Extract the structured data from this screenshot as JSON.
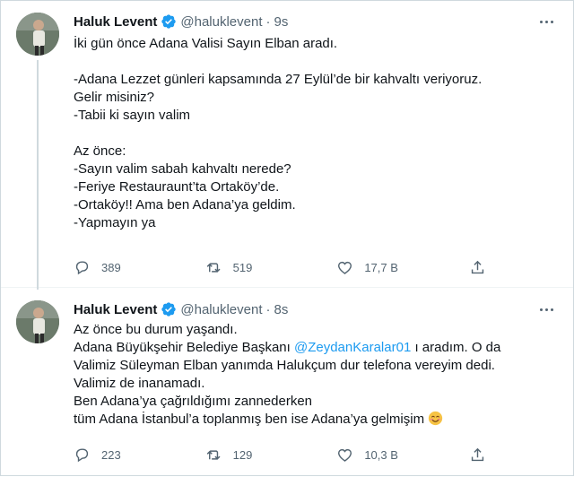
{
  "tweets": [
    {
      "author_name": "Haluk Levent",
      "handle": "@haluklevent",
      "separator": "·",
      "time": "9s",
      "lines": [
        "İki gün önce Adana Valisi Sayın Elban aradı.",
        "",
        "-Adana Lezzet günleri kapsamında 27 Eylül’de bir kahvaltı veriyoruz.",
        "Gelir misiniz?",
        "-Tabii ki sayın valim",
        "",
        "Az önce:",
        "-Sayın valim sabah kahvaltı nerede?",
        "-Feriye Restauraunt’ta Ortaköy’de.",
        "-Ortaköy!! Ama ben Adana’ya geldim.",
        "-Yapmayın ya"
      ],
      "reply_count": "389",
      "retweet_count": "519",
      "like_count": "17,7 B"
    },
    {
      "author_name": "Haluk Levent",
      "handle": "@haluklevent",
      "separator": "·",
      "time": "8s",
      "line1": "Az önce bu durum yaşandı.",
      "line2_before": "Adana Büyükşehir Belediye Başkanı ",
      "line2_mention": "@ZeydanKaralar01",
      "line2_after": " ı aradım. O da",
      "line3": "Valimiz Süleyman Elban yanımda Halukçum dur telefona vereyim dedi.",
      "line4": "Valimiz de inanamadı.",
      "line5": "Ben Adana’ya çağrıldığımı zannederken",
      "line6": "tüm Adana İstanbul’a toplanmış ben ise Adana’ya gelmişim",
      "emoji": "smiling-face-emoji",
      "reply_count": "223",
      "retweet_count": "129",
      "like_count": "10,3 B"
    }
  ],
  "colors": {
    "text": "#0f1419",
    "secondary": "#536471",
    "link": "#1d9bf0",
    "verified": "#1d9bf0",
    "border": "#cfd9de"
  },
  "icons": [
    "more-icon",
    "verified-icon",
    "reply-icon",
    "retweet-icon",
    "like-icon",
    "share-icon"
  ]
}
